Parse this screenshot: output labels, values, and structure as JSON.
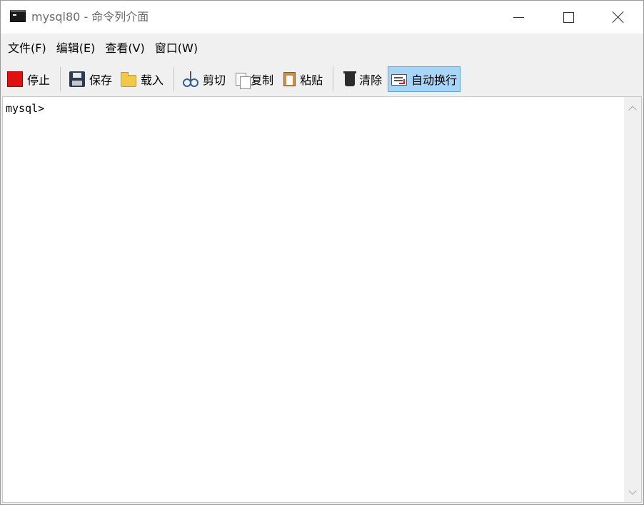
{
  "window": {
    "title": "mysql80 - 命令列介面",
    "icon": "console-app-icon"
  },
  "menu": {
    "items": [
      {
        "label": "文件(F)"
      },
      {
        "label": "编辑(E)"
      },
      {
        "label": "查看(V)"
      },
      {
        "label": "窗口(W)"
      }
    ]
  },
  "toolbar": {
    "stop": {
      "label": "停止",
      "icon": "stop-icon"
    },
    "save": {
      "label": "保存",
      "icon": "save-icon"
    },
    "load": {
      "label": "载入",
      "icon": "folder-icon"
    },
    "cut": {
      "label": "剪切",
      "icon": "scissors-icon"
    },
    "copy": {
      "label": "复制",
      "icon": "copy-icon"
    },
    "paste": {
      "label": "粘贴",
      "icon": "paste-icon"
    },
    "clear": {
      "label": "清除",
      "icon": "trash-icon"
    },
    "wrap": {
      "label": "自动换行",
      "icon": "word-wrap-icon",
      "active": true
    }
  },
  "console": {
    "prompt": "mysql>"
  },
  "colors": {
    "active_button_bg": "#a8d4f5",
    "active_button_border": "#5ba4dc",
    "stop_red": "#e01010"
  }
}
